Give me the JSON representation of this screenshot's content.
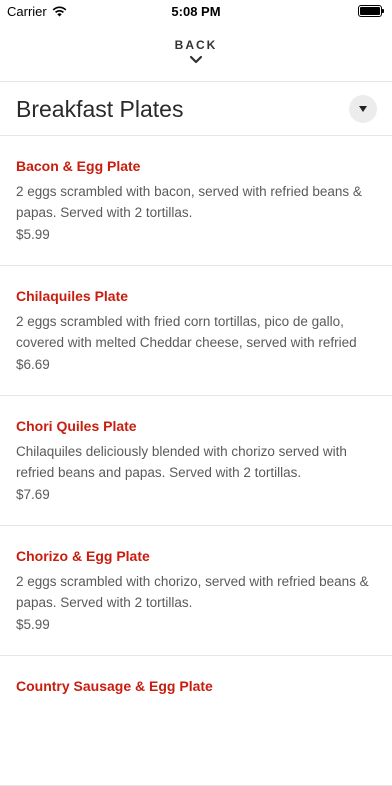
{
  "status_bar": {
    "carrier": "Carrier",
    "time": "5:08 PM"
  },
  "nav": {
    "back_label": "BACK"
  },
  "section": {
    "title": "Breakfast Plates"
  },
  "items": [
    {
      "name": "Bacon & Egg Plate",
      "description": "2 eggs scrambled with bacon, served with refried beans & papas. Served with 2 tortillas.",
      "price": "$5.99"
    },
    {
      "name": "Chilaquiles Plate",
      "description": "2 eggs scrambled with fried corn tortillas, pico de gallo, covered with melted Cheddar cheese, served with refried",
      "price": "$6.69"
    },
    {
      "name": "Chori Quiles Plate",
      "description": "Chilaquiles deliciously blended with chorizo  served with refried beans and papas. Served with 2 tortillas.",
      "price": "$7.69"
    },
    {
      "name": "Chorizo & Egg Plate",
      "description": "2 eggs scrambled with chorizo, served with  refried beans & papas. Served with 2 tortillas.",
      "price": "$5.99"
    },
    {
      "name": "Country Sausage & Egg Plate",
      "description": "",
      "price": ""
    }
  ],
  "colors": {
    "item_name": "#c81d0f",
    "text_secondary": "#5a5a5a",
    "divider": "#e6e6e6"
  }
}
